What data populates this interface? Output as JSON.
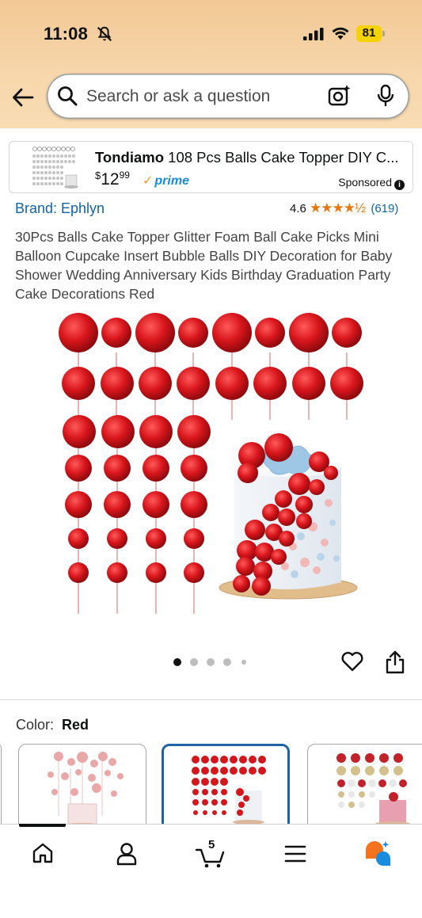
{
  "status_bar": {
    "time": "11:08",
    "battery": "81"
  },
  "search": {
    "placeholder": "Search or ask a question"
  },
  "sponsored_ad": {
    "brand": "Tondiamo",
    "title": "108 Pcs Balls Cake Topper DIY C...",
    "price_whole": "12",
    "price_fraction": "99",
    "currency": "$",
    "prime_label": "prime",
    "sponsored_label": "Sponsored"
  },
  "product": {
    "brand_link": "Brand: Ephlyn",
    "rating": "4.6",
    "stars": "★★★★½",
    "review_count": "(619)",
    "title": "30Pcs Balls Cake Topper Glitter Foam Ball Cake Picks Mini Balloon Cupcake Insert Bubble Balls DIY Decoration for Baby Shower Wedding Anniversary Kids Birthday Graduation Party Cake Decorations Red"
  },
  "gallery": {
    "dots": 5,
    "active_dot": 1
  },
  "variation": {
    "label": "Color:",
    "selected": "Red"
  },
  "bottom_nav": {
    "cart_count": "5",
    "items": [
      "home-icon",
      "account-icon",
      "cart-icon",
      "menu-icon",
      "rufus-icon"
    ]
  },
  "colors": {
    "accent_red": "#c8141b",
    "link_blue": "#1264a3",
    "star_orange": "#e47911",
    "selected_border": "#2162a1"
  }
}
